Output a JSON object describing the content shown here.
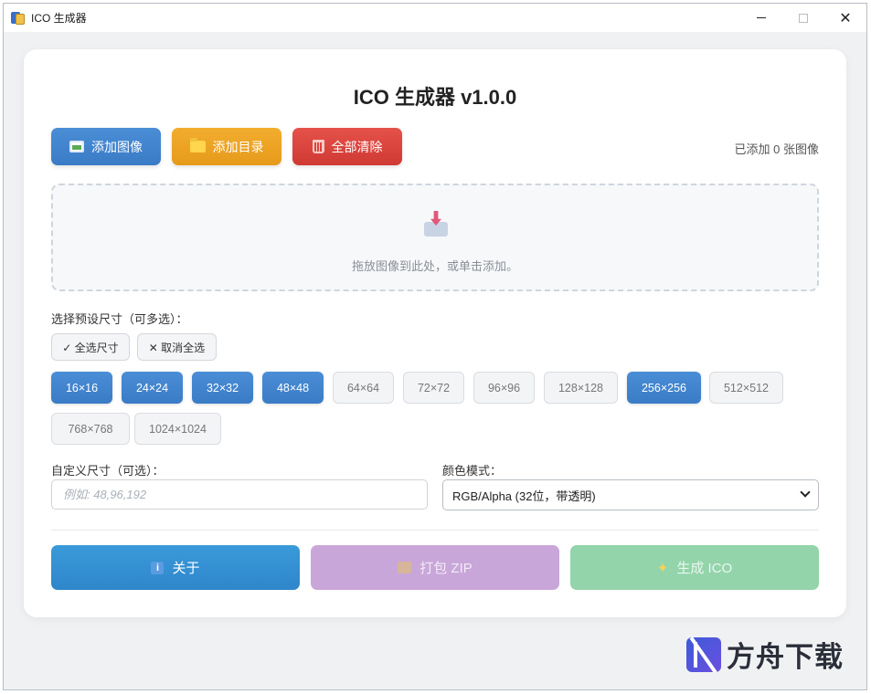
{
  "window": {
    "title": "ICO 生成器",
    "controls": {
      "minimize": "minimize-icon",
      "maximize": "maximize-icon",
      "close": "✕"
    }
  },
  "header": {
    "title": "ICO 生成器 v1.0.0"
  },
  "toolbar": {
    "add_image": "添加图像",
    "add_directory": "添加目录",
    "clear_all": "全部清除",
    "count_text": "已添加 0 张图像"
  },
  "dropzone": {
    "hint": "拖放图像到此处，或单击添加。"
  },
  "presets": {
    "label": "选择预设尺寸（可多选）：",
    "select_all": "✓ 全选尺寸",
    "deselect_all": "✕ 取消全选",
    "sizes": [
      {
        "label": "16×16",
        "selected": true
      },
      {
        "label": "24×24",
        "selected": true
      },
      {
        "label": "32×32",
        "selected": true
      },
      {
        "label": "48×48",
        "selected": true
      },
      {
        "label": "64×64",
        "selected": false
      },
      {
        "label": "72×72",
        "selected": false
      },
      {
        "label": "96×96",
        "selected": false
      },
      {
        "label": "128×128",
        "selected": false
      },
      {
        "label": "256×256",
        "selected": true
      },
      {
        "label": "512×512",
        "selected": false
      },
      {
        "label": "768×768",
        "selected": false
      },
      {
        "label": "1024×1024",
        "selected": false
      }
    ]
  },
  "custom_size": {
    "label": "自定义尺寸（可选）：",
    "placeholder": "例如: 48,96,192",
    "value": ""
  },
  "color_mode": {
    "label": "颜色模式：",
    "selected": "RGB/Alpha (32位，带透明)"
  },
  "actions": {
    "about": "关于",
    "zip": "打包 ZIP",
    "generate": "生成 ICO"
  },
  "watermark": {
    "text": "方舟下载"
  },
  "colors": {
    "accent": "#3a7bc6",
    "orange": "#e69a1a",
    "red": "#cf3a33",
    "zip": "#c9a6d9",
    "generate": "#93d4ab"
  }
}
